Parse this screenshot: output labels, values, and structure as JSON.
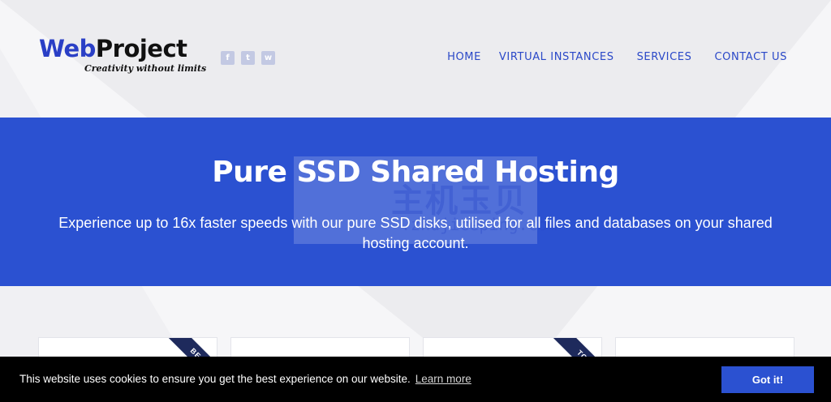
{
  "logo": {
    "brand_w": "Web",
    "brand_rest": "Project",
    "tagline": "Creativity without limits"
  },
  "social": [
    {
      "glyph": "f",
      "icon": "facebook-icon"
    },
    {
      "glyph": "t",
      "icon": "twitter-icon"
    },
    {
      "glyph": "w",
      "icon": "whatsapp-icon"
    }
  ],
  "nav": {
    "home": "HOME",
    "virtual_instances": "VIRTUAL INSTANCES",
    "services": "SERVICES",
    "contact": "CONTACT US"
  },
  "hero": {
    "title": "Pure SSD Shared Hosting",
    "subtitle": "Experience up to 16x faster speeds with our pure SSD disks, utilised for all files and databases on your shared hosting account."
  },
  "cards": {
    "ribbon_best": "BEST",
    "ribbon_top": "TOP"
  },
  "cookie": {
    "message": "This website uses cookies to ensure you get the best experience on our website.",
    "learn_more": "Learn more",
    "accept": "Got it!"
  },
  "colors": {
    "accent": "#2b51d1",
    "nav_text": "#2a48c8",
    "ribbon": "#1e2a5c",
    "cookie_bg": "#000000"
  }
}
